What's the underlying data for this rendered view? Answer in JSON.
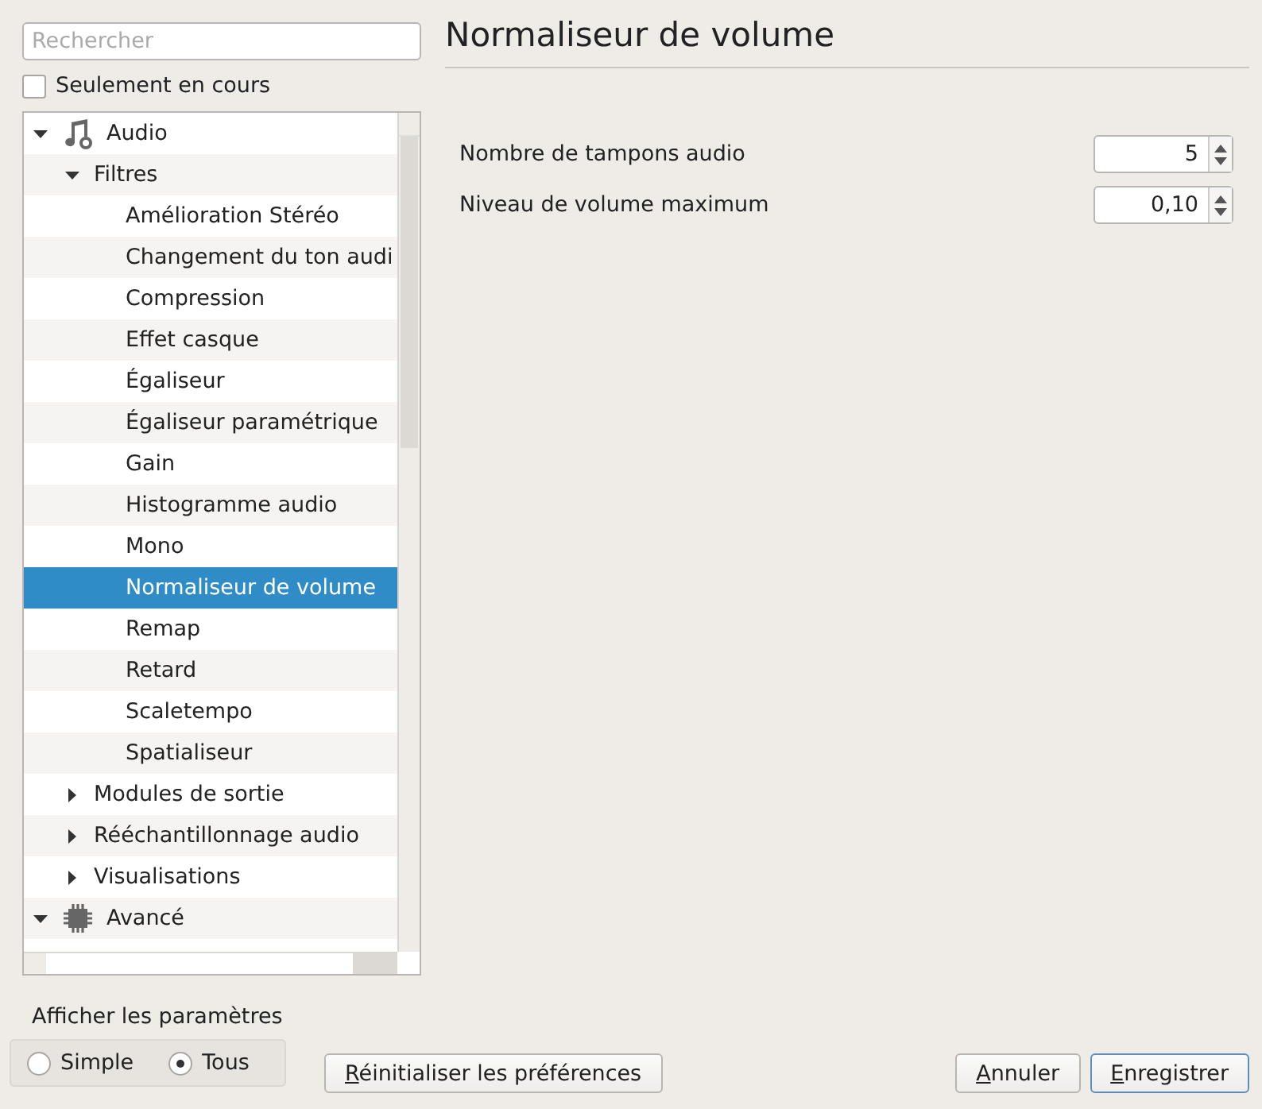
{
  "search": {
    "placeholder": "Rechercher"
  },
  "only_current": {
    "label": "Seulement en cours",
    "checked": false
  },
  "tree": [
    {
      "label": "Audio",
      "expanded": true,
      "selected": false,
      "children": [
        {
          "label": "Filtres",
          "expanded": true,
          "selected": false,
          "children": [
            {
              "label": "Amélioration Stéréo",
              "selected": false
            },
            {
              "label": "Changement du ton audi",
              "selected": false
            },
            {
              "label": "Compression",
              "selected": false
            },
            {
              "label": "Effet casque",
              "selected": false
            },
            {
              "label": "Égaliseur",
              "selected": false
            },
            {
              "label": "Égaliseur paramétrique",
              "selected": false
            },
            {
              "label": "Gain",
              "selected": false
            },
            {
              "label": "Histogramme audio",
              "selected": false
            },
            {
              "label": "Mono",
              "selected": false
            },
            {
              "label": "Normaliseur de volume",
              "selected": true
            },
            {
              "label": "Remap",
              "selected": false
            },
            {
              "label": "Retard",
              "selected": false
            },
            {
              "label": "Scaletempo",
              "selected": false
            },
            {
              "label": "Spatialiseur",
              "selected": false
            }
          ]
        },
        {
          "label": "Modules de sortie",
          "expanded": false,
          "selected": false
        },
        {
          "label": "Rééchantillonnage audio",
          "expanded": false,
          "selected": false
        },
        {
          "label": "Visualisations",
          "expanded": false,
          "selected": false
        }
      ]
    },
    {
      "label": "Avancé",
      "expanded": true,
      "selected": false
    }
  ],
  "show_settings": {
    "label": "Afficher les paramètres",
    "options": [
      {
        "label": "Simple",
        "selected": false
      },
      {
        "label": "Tous",
        "selected": true
      }
    ]
  },
  "panel": {
    "title": "Normaliseur de volume",
    "settings": [
      {
        "label": "Nombre de tampons audio",
        "value": "5"
      },
      {
        "label": "Niveau de volume maximum",
        "value": "0,10"
      }
    ]
  },
  "buttons": [
    {
      "label": "Réinitialiser les préférences"
    },
    {
      "label": "Annuler"
    },
    {
      "label": "Enregistrer",
      "default": true
    }
  ]
}
